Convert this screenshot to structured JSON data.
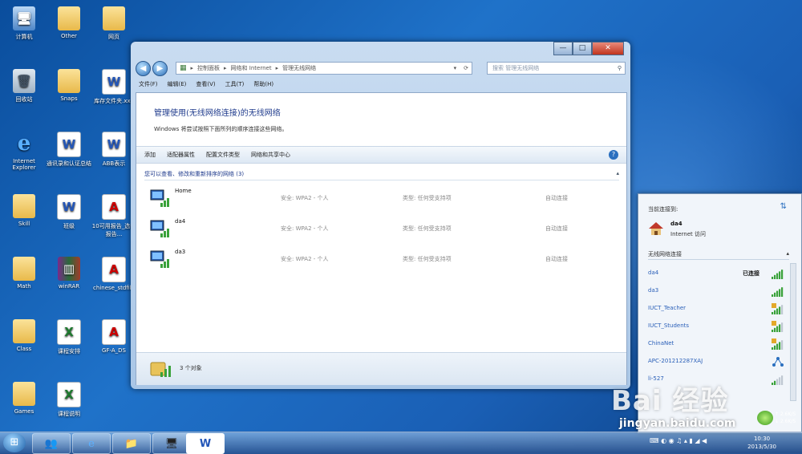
{
  "desktop": {
    "icons": [
      {
        "label": "计算机",
        "glyph": "🖥",
        "kind": "pc"
      },
      {
        "label": "Other",
        "glyph": "",
        "kind": "folder"
      },
      {
        "label": "网页",
        "glyph": "",
        "kind": "folder"
      },
      {
        "label": "回收站",
        "glyph": "🗑",
        "kind": "trash"
      },
      {
        "label": "Snaps",
        "glyph": "",
        "kind": "folder"
      },
      {
        "label": "库存文件夹.xxx",
        "glyph": "W",
        "kind": "doc"
      },
      {
        "label": "Internet Explorer",
        "glyph": "e",
        "kind": "ie"
      },
      {
        "label": "通讯录和认证总结",
        "glyph": "W",
        "kind": "doc"
      },
      {
        "label": "ABB表示",
        "glyph": "W",
        "kind": "doc"
      },
      {
        "label": "Skill",
        "glyph": "",
        "kind": "folder"
      },
      {
        "label": "班级",
        "glyph": "W",
        "kind": "doc"
      },
      {
        "label": "10可用报告_选举报告...",
        "glyph": "A",
        "kind": "pdf"
      },
      {
        "label": "Math",
        "glyph": "",
        "kind": "folder"
      },
      {
        "label": "winRAR",
        "glyph": "▥",
        "kind": "rar"
      },
      {
        "label": "chinese_stdfile",
        "glyph": "A",
        "kind": "pdf"
      },
      {
        "label": "Class",
        "glyph": "",
        "kind": "folder"
      },
      {
        "label": "课程安排",
        "glyph": "X",
        "kind": "xls"
      },
      {
        "label": "GF-A_DS",
        "glyph": "A",
        "kind": "pdf"
      },
      {
        "label": "Games",
        "glyph": "",
        "kind": "folder"
      },
      {
        "label": "课程说明",
        "glyph": "X",
        "kind": "xls"
      }
    ]
  },
  "window": {
    "minimize": "—",
    "maximize": "□",
    "close": "✕",
    "nav_back": "◀",
    "nav_forward": "▶",
    "breadcrumb": [
      "控制面板",
      "网络和 Internet",
      "管理无线网络"
    ],
    "search_placeholder": "搜索 管理无线网络",
    "menu": [
      "文件(F)",
      "编辑(E)",
      "查看(V)",
      "工具(T)",
      "帮助(H)"
    ],
    "heading": "管理使用(无线网络连接)的无线网络",
    "subheading": "Windows 将尝试按照下面所列的顺序连接这些网络。",
    "toolbar": [
      "添加",
      "适配器属性",
      "配置文件类型",
      "网络和共享中心"
    ],
    "help": "?",
    "group_header": "您可以查看、修改和重新排序的网络 (3)",
    "networks": [
      {
        "name": "Home",
        "security": "安全: WPA2 - 个人",
        "type": "类型: 任何受支持项",
        "auto": "自动连接"
      },
      {
        "name": "da4",
        "security": "安全: WPA2 - 个人",
        "type": "类型: 任何受支持项",
        "auto": "自动连接"
      },
      {
        "name": "da3",
        "security": "安全: WPA2 - 个人",
        "type": "类型: 任何受支持项",
        "auto": "自动连接"
      }
    ],
    "status_count": "3 个对象"
  },
  "wifi_popup": {
    "title": "当前连接到:",
    "connected_name": "da4",
    "connected_access": "Internet 访问",
    "section": "无线网络连接",
    "status_connected": "已连接",
    "items": [
      {
        "name": "da4",
        "status": "已连接",
        "bars": 5,
        "secure": false
      },
      {
        "name": "da3",
        "status": "",
        "bars": 5,
        "secure": false
      },
      {
        "name": "IUCT_Teacher",
        "status": "",
        "bars": 4,
        "secure": true
      },
      {
        "name": "IUCT_Students",
        "status": "",
        "bars": 4,
        "secure": true
      },
      {
        "name": "ChinaNet",
        "status": "",
        "bars": 4,
        "secure": true
      },
      {
        "name": "APC-201212287XAJ",
        "status": "",
        "bars": 0,
        "secure": false
      },
      {
        "name": "li-527",
        "status": "",
        "bars": 2,
        "secure": false
      }
    ]
  },
  "taskbar": {
    "start": "⊞",
    "apps": [
      "👥",
      "e",
      "📁",
      "🖥",
      "W"
    ],
    "time": "10:30",
    "date": "2013/5/30",
    "tray": "⌨ ◐ ◉ ♫ ▴ ▮ ◢ ◀"
  },
  "overlay": {
    "net_up": "↑ 2.6K/S",
    "net_down": "↓ 2.6K/S",
    "watermark": "Bai 经验",
    "watermark_url": "jingyan.baidu.com"
  },
  "colors": {
    "accent": "#2a6fbf",
    "desktop": "#1f72c9",
    "link": "#1e3a8c"
  }
}
